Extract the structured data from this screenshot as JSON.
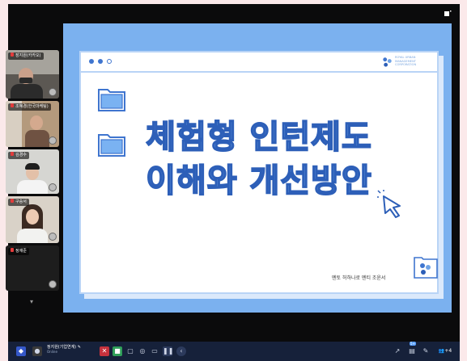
{
  "window": {
    "fullscreen_icon": "fullscreen-exit-icon"
  },
  "participants": [
    {
      "name": "장지원(카카오)",
      "icon": "mic-muted-icon"
    },
    {
      "name": "조혜경(한국마케팅)",
      "icon": "mic-muted-icon"
    },
    {
      "name": "김경수",
      "icon": "mic-muted-icon"
    },
    {
      "name": "구승서",
      "icon": "mic-muted-icon"
    },
    {
      "name": "정재준",
      "icon": "mic-muted-icon"
    }
  ],
  "slide": {
    "title_line1": "체험형 인턴제도",
    "title_line2": "이해와 개선방안",
    "logo_text": [
      "ROYAL URBAN",
      "MANAGEMENT",
      "CORPORATION"
    ],
    "presenter": "멘토 허하나로 멘티 조윤서",
    "accent_color": "#3f75cf",
    "background_color": "#7bb1ef"
  },
  "toolbar": {
    "self_name": "정지원(기업연계) ✎",
    "self_status": "Online",
    "count_badge": "5+",
    "participants_count": "+4"
  }
}
